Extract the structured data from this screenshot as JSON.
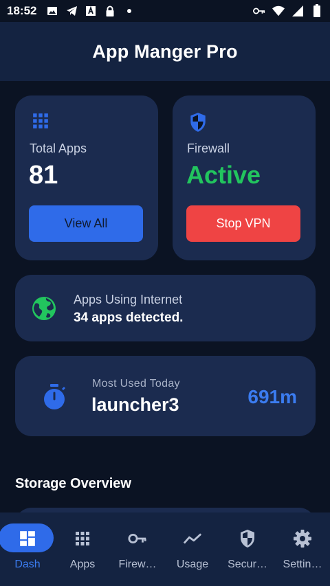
{
  "status_bar": {
    "time": "18:52",
    "icons_left": [
      "image-icon",
      "telegram-icon",
      "a-box-icon",
      "lock-icon",
      "dot-icon"
    ],
    "icons_right": [
      "key-icon",
      "wifi-icon",
      "signal-icon",
      "battery-icon"
    ]
  },
  "header": {
    "title": "App Manger Pro"
  },
  "apps_card": {
    "icon": "grid-icon",
    "label": "Total Apps",
    "value": "81",
    "button": "View All"
  },
  "firewall_card": {
    "icon": "shield-icon",
    "label": "Firewall",
    "value": "Active",
    "button": "Stop VPN"
  },
  "internet_card": {
    "icon": "globe-icon",
    "label": "Apps Using Internet",
    "value": "34 apps detected."
  },
  "usage_card": {
    "icon": "timer-icon",
    "label": "Most Used Today",
    "app": "launcher3",
    "time": "691m"
  },
  "storage": {
    "title": "Storage Overview"
  },
  "nav": {
    "items": [
      {
        "label": "Dash",
        "icon": "dashboard-icon",
        "active": true
      },
      {
        "label": "Apps",
        "icon": "grid-icon",
        "active": false
      },
      {
        "label": "Firew…",
        "icon": "key-icon",
        "active": false
      },
      {
        "label": "Usage",
        "icon": "trend-icon",
        "active": false
      },
      {
        "label": "Secur…",
        "icon": "shield-icon",
        "active": false
      },
      {
        "label": "Settin…",
        "icon": "gear-icon",
        "active": false
      }
    ]
  },
  "colors": {
    "background": "#0b1323",
    "header": "#142341",
    "card": "#1b2b4f",
    "accent_blue": "#2f6be9",
    "active_green": "#22c55e",
    "danger_red": "#ef4444"
  }
}
